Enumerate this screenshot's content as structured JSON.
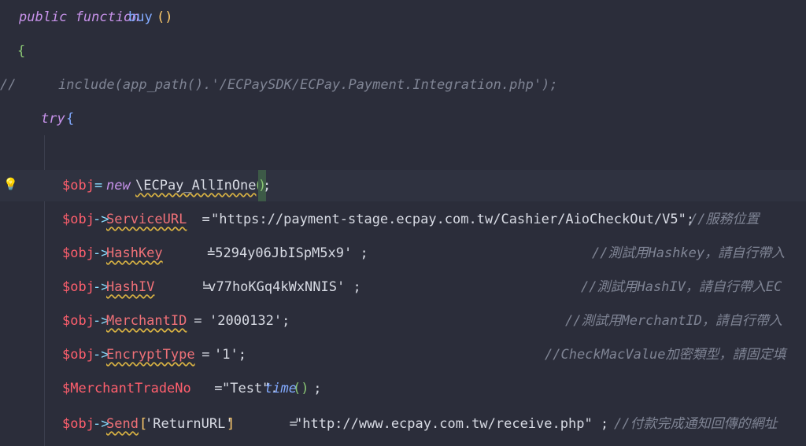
{
  "code": {
    "l1": {
      "kw": "public function",
      "fn": "buy",
      "parens": "()"
    },
    "l2": {
      "brace": "{"
    },
    "l3": {
      "comment_mark": "//",
      "text": "include(app_path().'/ECPaySDK/ECPay.Payment.Integration.php');"
    },
    "l4": {
      "kw": "try",
      "brace": "{"
    },
    "l6": {
      "var": "$obj",
      "eq": "=",
      "kw": "new",
      "cls": "\\ECPay_AllInOne",
      "paren_open": "(",
      "paren_close": ")",
      "end": ";"
    },
    "l7": {
      "var": "$obj",
      "arrow": "->",
      "prop": "ServiceURL",
      "assign": "  = ",
      "str": "\"https://payment-stage.ecpay.com.tw/Cashier/AioCheckOut/V5\";",
      "comment": "//服務位置"
    },
    "l8": {
      "var": "$obj",
      "arrow": "->",
      "prop": "HashKey",
      "assign": "     = ",
      "str": "'5294y06JbISpM5x9' ;",
      "comment": "//測試用Hashkey，請自行帶入"
    },
    "l9": {
      "var": "$obj",
      "arrow": "->",
      "prop": "HashIV",
      "assign": "      = ",
      "str": "'v77hoKGq4kWxNNIS' ;",
      "comment": "//測試用HashIV，請自行帶入EC"
    },
    "l10": {
      "var": "$obj",
      "arrow": "->",
      "prop": "MerchantID",
      "assign": " = ",
      "str": "'2000132';",
      "comment": "//測試用MerchantID，請自行帶入"
    },
    "l11": {
      "var": "$obj",
      "arrow": "->",
      "prop": "EncryptType",
      "assign": " = ",
      "str": "'1';",
      "comment": "//CheckMacValue加密類型，請固定填"
    },
    "l12": {
      "var": "$MerchantTradeNo",
      "assign": " = ",
      "str": "\"Test\".",
      "method": "time",
      "parens": "()",
      "end": " ;"
    },
    "l13": {
      "var": "$obj",
      "arrow": "->",
      "prop": "Send",
      "bracket_open": "[",
      "key": "'ReturnURL'",
      "bracket_close": "]",
      "assign": "       = ",
      "str": "\"http://www.ecpay.com.tw/receive.php\" ;",
      "comment": "//付款完成通知回傳的網址"
    }
  },
  "icons": {
    "hint": "lightbulb-icon"
  },
  "colors": {
    "background": "#2b2d3a",
    "keyword": "#c792ea",
    "variable": "#ff5f6d",
    "function": "#82aaff",
    "comment": "#7f8494"
  }
}
